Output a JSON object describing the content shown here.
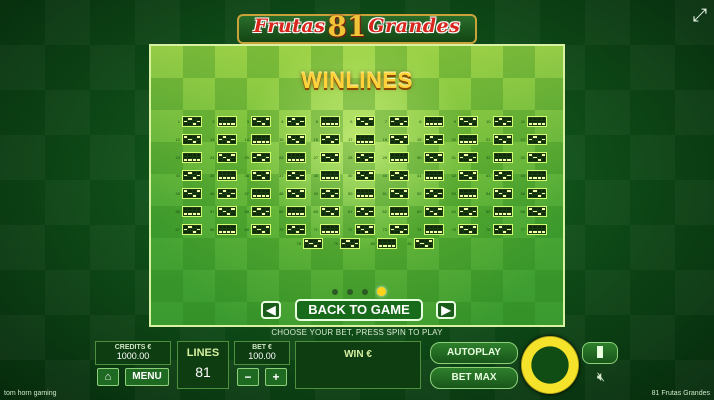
{
  "logo": {
    "left": "Frutas",
    "num": "81",
    "right": "Grandes"
  },
  "panel": {
    "title": "WINLINES",
    "back_label": "BACK TO GAME",
    "prev_icon": "arrow-left-icon",
    "next_icon": "arrow-right-icon",
    "pages": 4,
    "active_page": 4,
    "lines_grid": [
      "1",
      "2",
      "3",
      "4",
      "5",
      "6",
      "7",
      "8",
      "9",
      "10",
      "11",
      "12",
      "13",
      "14",
      "15",
      "16",
      "17",
      "18",
      "19",
      "20",
      "21",
      "22",
      "23",
      "24",
      "25",
      "26",
      "27",
      "28",
      "29",
      "30",
      "31",
      "32",
      "33",
      "34",
      "35",
      "36",
      "37",
      "38",
      "39",
      "40",
      "41",
      "42",
      "43",
      "44",
      "45",
      "46",
      "47",
      "48",
      "49",
      "50",
      "51",
      "52",
      "53",
      "54",
      "55",
      "56",
      "57",
      "58",
      "59",
      "60",
      "61",
      "62",
      "63",
      "64",
      "65",
      "66",
      "67",
      "68",
      "69",
      "70",
      "71",
      "72",
      "73",
      "74",
      "75",
      "76",
      "77"
    ],
    "lines_last": [
      "78",
      "79",
      "80",
      "81"
    ]
  },
  "hint": "CHOOSE YOUR BET, PRESS SPIN TO PLAY",
  "credits": {
    "label": "CREDITS €",
    "value": "1000.00"
  },
  "menu_label": "MENU",
  "lines": {
    "label": "LINES",
    "value": "81"
  },
  "bet": {
    "label": "BET €",
    "value": "100.00"
  },
  "win": {
    "label": "WIN €"
  },
  "autoplay_label": "AUTOPLAY",
  "betmax_label": "BET MAX",
  "footer": {
    "left": "tom horn gaming",
    "right": "81 Frutas Grandes"
  }
}
